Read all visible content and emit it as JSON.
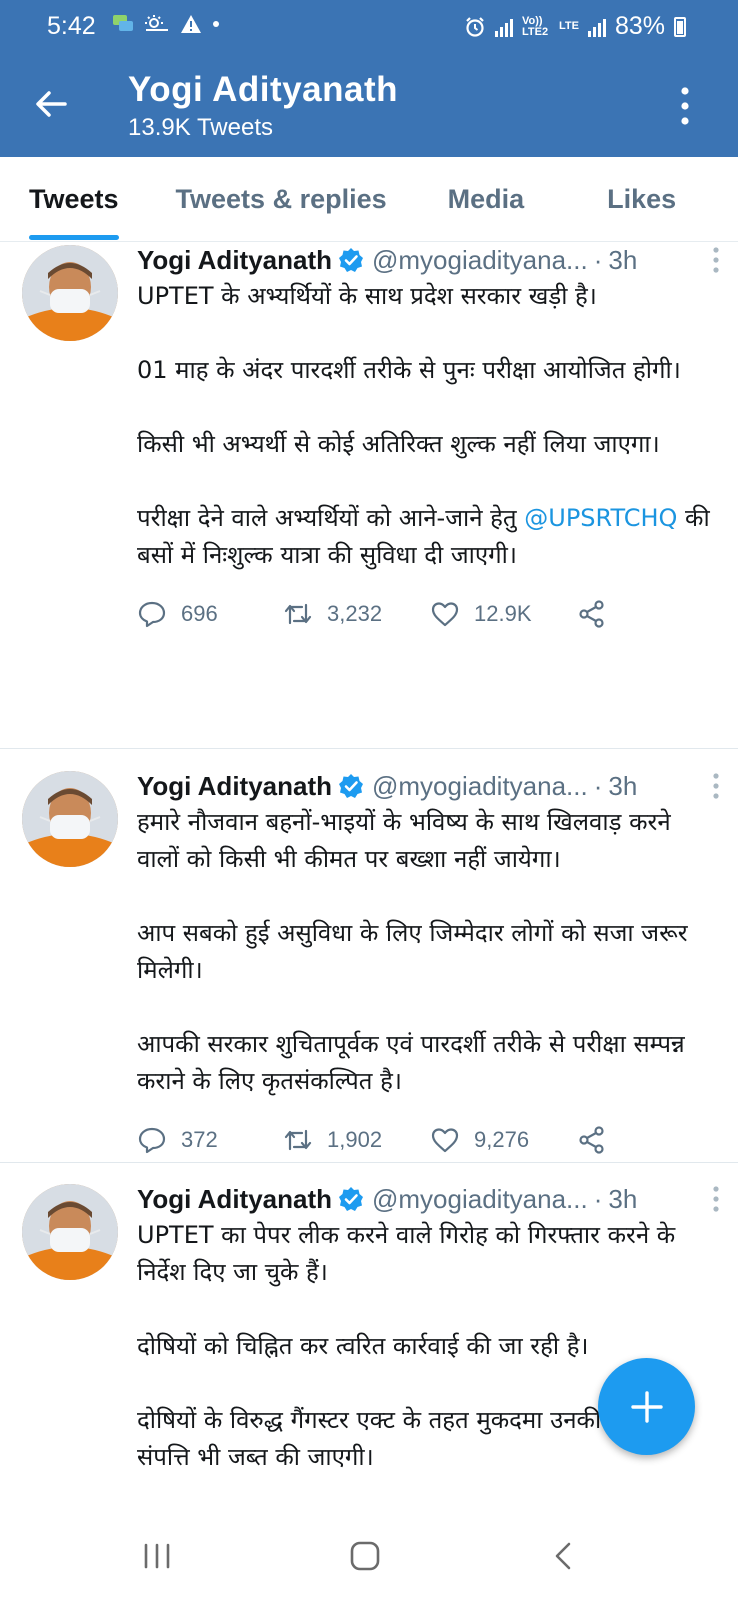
{
  "status_bar": {
    "time": "5:42",
    "network_label": "Vo)) LTE2",
    "lte_label": "LTE",
    "battery": "83%"
  },
  "app_bar": {
    "title": "Yogi Adityanath",
    "subtitle": "13.9K Tweets"
  },
  "tabs": [
    {
      "label": "Tweets",
      "active": true
    },
    {
      "label": "Tweets & replies",
      "active": false
    },
    {
      "label": "Media",
      "active": false
    },
    {
      "label": "Likes",
      "active": false
    }
  ],
  "tweets": [
    {
      "name": "Yogi Adityanath",
      "handle": "@myogiadityana...",
      "time": "3h",
      "paragraphs": [
        "UPTET के अभ्यर्थियों के साथ प्रदेश सरकार खड़ी है।",
        "01 माह के अंदर पारदर्शी तरीके से पुनः परीक्षा आयोजित होगी।",
        "किसी भी अभ्यर्थी से कोई अतिरिक्त शुल्क नहीं लिया जाएगा।"
      ],
      "last_paragraph_before": "परीक्षा देने वाले अभ्यर्थियों को आने-जाने हेतु ",
      "mention": "@UPSRTCHQ",
      "last_paragraph_after": " की बसों में निःशुल्क यात्रा की सुविधा दी जाएगी।",
      "replies": "696",
      "retweets": "3,232",
      "likes": "12.9K"
    },
    {
      "name": "Yogi Adityanath",
      "handle": "@myogiadityana...",
      "time": "3h",
      "paragraphs": [
        "हमारे नौजवान बहनों-भाइयों के भविष्य के साथ खिलवाड़ करने वालों को किसी भी कीमत पर बख्शा नहीं जायेगा।",
        "आप सबको हुई असुविधा के लिए जिम्मेदार लोगों को सजा जरूर मिलेगी।",
        "आपकी सरकार शुचितापूर्वक एवं पारदर्शी तरीके से परीक्षा सम्पन्न कराने के लिए कृतसंकल्पित है।"
      ],
      "replies": "372",
      "retweets": "1,902",
      "likes": "9,276"
    },
    {
      "name": "Yogi Adityanath",
      "handle": "@myogiadityana...",
      "time": "3h",
      "paragraphs": [
        "UPTET का पेपर लीक करने वाले गिरोह को गिरफ्तार करने के निर्देश दिए जा चुके हैं।",
        "दोषियों को चिह्नित कर त्वरित कार्रवाई की जा रही है।",
        "दोषियों के विरुद्ध गैंगस्टर एक्ट के तहत मुकदमा उनकी संपत्ति भी जब्त की जाएगी।"
      ]
    }
  ],
  "icons": {
    "back": "arrow-left-icon",
    "more": "more-vertical-icon",
    "verified": "verified-badge-icon",
    "reply": "reply-icon",
    "retweet": "retweet-icon",
    "like": "heart-icon",
    "share": "share-icon",
    "compose": "plus-icon",
    "nav_recents": "recents-icon",
    "nav_home": "home-icon",
    "nav_back": "back-icon"
  },
  "colors": {
    "header": "#3b74b4",
    "accent": "#1d9bf0",
    "mention": "#1b95e0",
    "muted": "#5b7083"
  }
}
